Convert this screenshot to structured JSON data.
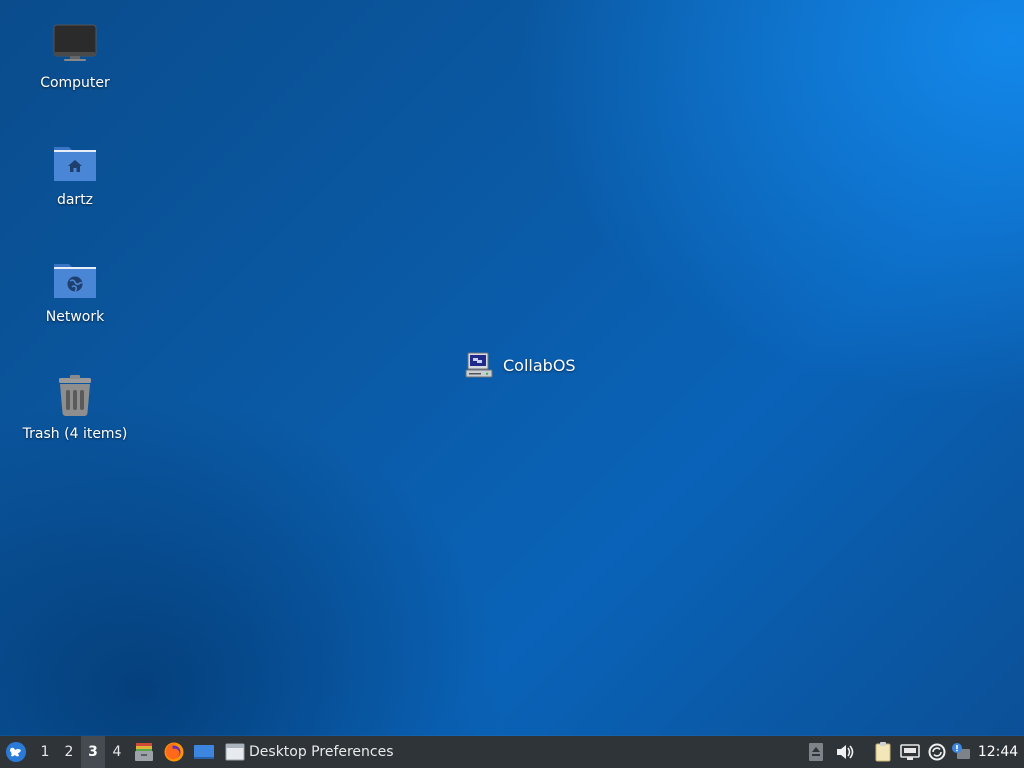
{
  "desktop": {
    "icons": [
      {
        "label": "Computer",
        "icon": "computer-icon"
      },
      {
        "label": "dartz",
        "icon": "home-folder-icon"
      },
      {
        "label": "Network",
        "icon": "network-folder-icon"
      },
      {
        "label": "Trash (4 items)",
        "icon": "trash-icon"
      }
    ],
    "floating": {
      "label": "CollabOS",
      "icon": "collabos-computer-icon"
    }
  },
  "taskbar": {
    "workspaces": [
      "1",
      "2",
      "3",
      "4"
    ],
    "active_workspace": "3",
    "launchers": [
      {
        "name": "whisker-menu",
        "icon": "xubuntu-logo-icon"
      },
      {
        "name": "file-manager",
        "icon": "file-manager-icon"
      },
      {
        "name": "firefox",
        "icon": "firefox-icon"
      },
      {
        "name": "show-desktop",
        "icon": "desktop-icon"
      }
    ],
    "task": {
      "label": "Desktop Preferences",
      "icon": "window-icon"
    },
    "tray": [
      {
        "name": "eject",
        "icon": "eject-icon"
      },
      {
        "name": "volume",
        "icon": "volume-icon"
      },
      {
        "name": "clipboard",
        "icon": "clipboard-icon"
      },
      {
        "name": "network",
        "icon": "network-wired-icon"
      },
      {
        "name": "updates",
        "icon": "update-icon"
      },
      {
        "name": "notifications",
        "icon": "notification-icon"
      }
    ],
    "clock": "12:44"
  },
  "colors": {
    "panel": "#2f3438",
    "accent": "#4c8fdd",
    "folder": "#4a86d6"
  }
}
